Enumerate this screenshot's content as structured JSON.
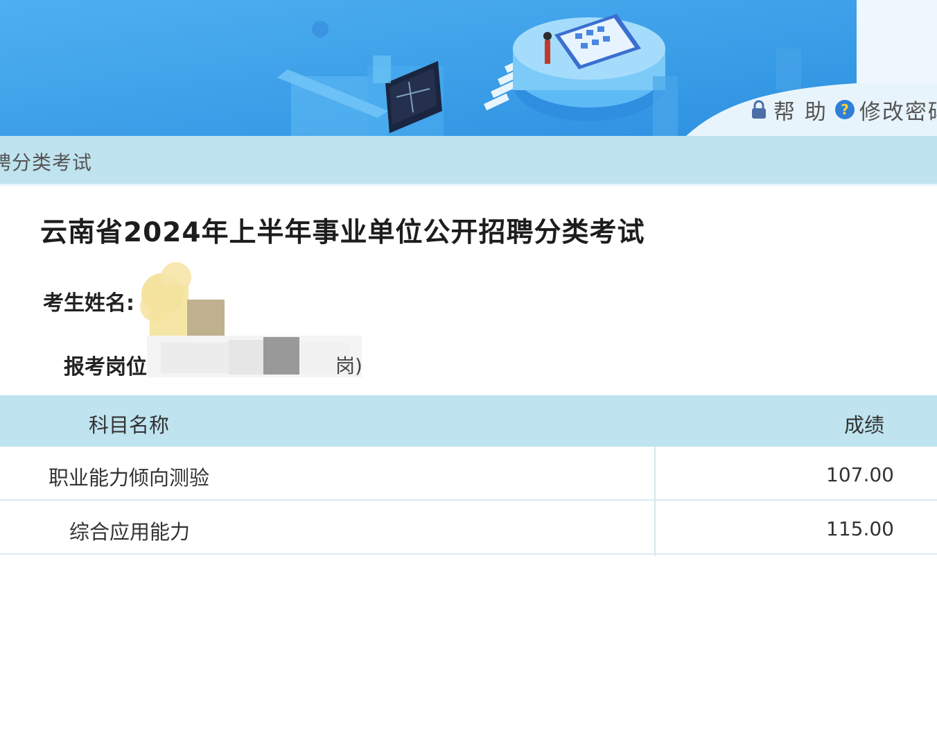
{
  "header": {
    "help_label": "帮 助",
    "change_password_label": "修改密码",
    "help_icon": "lock-icon",
    "password_icon": "question-circle-icon"
  },
  "breadcrumb": {
    "text": "聘分类考试"
  },
  "exam": {
    "title": "云南省2024年上半年事业单位公开招聘分类考试",
    "name_label": "考生姓名:",
    "post_label": "报考岗位:",
    "post_suffix": "岗)"
  },
  "scores": {
    "columns": [
      "科目名称",
      "成绩"
    ],
    "rows": [
      {
        "subject": "职业能力倾向测验",
        "score": "107.00"
      },
      {
        "subject": "综合应用能力",
        "score": "115.00"
      }
    ]
  },
  "colors": {
    "banner": "#3aa0ea",
    "band": "#bfe3ef",
    "title": "#1d1d1d"
  }
}
